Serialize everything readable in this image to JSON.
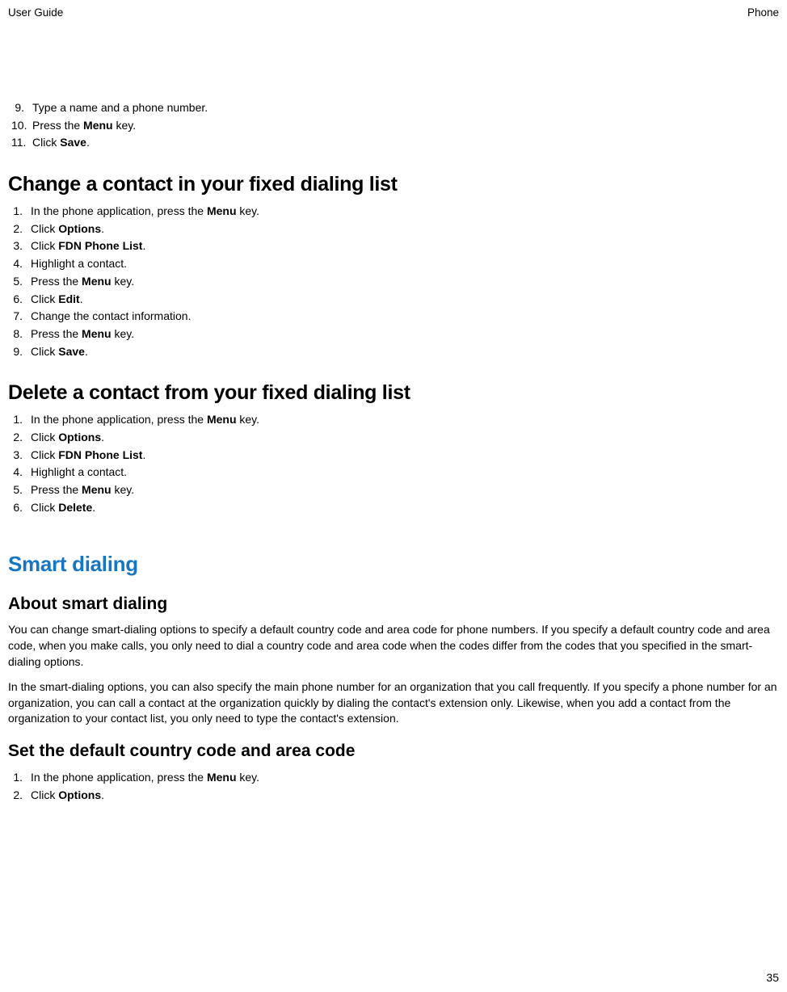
{
  "header": {
    "left": "User Guide",
    "right": "Phone"
  },
  "top_steps": {
    "s9_num": "9.",
    "s9_txt": "Type a name and a phone number.",
    "s10_num": "10.",
    "s10_a": "Press the ",
    "s10_b": "Menu",
    "s10_c": " key.",
    "s11_num": "11.",
    "s11_a": "Click ",
    "s11_b": "Save",
    "s11_c": "."
  },
  "h_change": "Change a contact in your fixed dialing list",
  "change": {
    "s1_num": "1.",
    "s1_a": "In the phone application, press the ",
    "s1_b": "Menu",
    "s1_c": " key.",
    "s2_num": "2.",
    "s2_a": "Click ",
    "s2_b": "Options",
    "s2_c": ".",
    "s3_num": "3.",
    "s3_a": "Click ",
    "s3_b": "FDN Phone List",
    "s3_c": ".",
    "s4_num": "4.",
    "s4_txt": "Highlight a contact.",
    "s5_num": "5.",
    "s5_a": "Press the ",
    "s5_b": "Menu",
    "s5_c": " key.",
    "s6_num": "6.",
    "s6_a": "Click ",
    "s6_b": "Edit",
    "s6_c": ".",
    "s7_num": "7.",
    "s7_txt": "Change the contact information.",
    "s8_num": "8.",
    "s8_a": "Press the ",
    "s8_b": "Menu",
    "s8_c": " key.",
    "s9_num": "9.",
    "s9_a": "Click ",
    "s9_b": "Save",
    "s9_c": "."
  },
  "h_delete": "Delete a contact from your fixed dialing list",
  "del": {
    "s1_num": "1.",
    "s1_a": "In the phone application, press the ",
    "s1_b": "Menu",
    "s1_c": " key.",
    "s2_num": "2.",
    "s2_a": "Click ",
    "s2_b": "Options",
    "s2_c": ".",
    "s3_num": "3.",
    "s3_a": "Click ",
    "s3_b": "FDN Phone List",
    "s3_c": ".",
    "s4_num": "4.",
    "s4_txt": "Highlight a contact.",
    "s5_num": "5.",
    "s5_a": "Press the ",
    "s5_b": "Menu",
    "s5_c": " key.",
    "s6_num": "6.",
    "s6_a": "Click ",
    "s6_b": "Delete",
    "s6_c": "."
  },
  "h_smart": "Smart dialing",
  "h_about": "About smart dialing",
  "p1": "You can change smart-dialing options to specify a default country code and area code for phone numbers. If you specify a default country code and area code, when you make calls, you only need to dial a country code and area code when the codes differ from the codes that you specified in the smart-dialing options.",
  "p2": "In the smart-dialing options, you can also specify the main phone number for an organization that you call frequently. If you specify a phone number for an organization, you can call a contact at the organization quickly by dialing the contact's extension only. Likewise, when you add a contact from the organization to your contact list, you only need to type the contact's extension.",
  "h_setdef": "Set the default country code and area code",
  "setdef": {
    "s1_num": "1.",
    "s1_a": "In the phone application, press the ",
    "s1_b": "Menu",
    "s1_c": " key.",
    "s2_num": "2.",
    "s2_a": "Click ",
    "s2_b": "Options",
    "s2_c": "."
  },
  "page_num": "35"
}
